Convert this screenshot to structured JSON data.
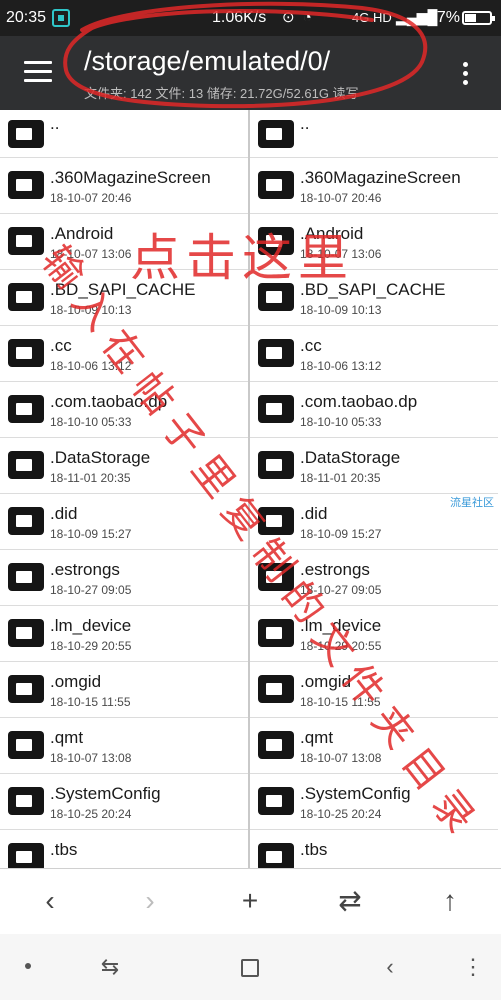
{
  "status_bar": {
    "time": "20:35",
    "speed": "1.06K/s",
    "icons": "⊙ ◔",
    "network": "4G HD",
    "signal": "▂▄▆█",
    "battery_pct": "47%",
    "battery_level": 0.47
  },
  "app_bar": {
    "path": "/storage/emulated/0/",
    "info": "文件夹: 142  文件: 13  储存: 21.72G/52.61G  读写"
  },
  "left_pane": {
    "items": [
      {
        "name": "..",
        "date": ""
      },
      {
        "name": ".360MagazineScreen",
        "date": "18-10-07 20:46"
      },
      {
        "name": ".Android",
        "date": "18-10-07 13:06"
      },
      {
        "name": ".BD_SAPI_CACHE",
        "date": "18-10-09 10:13"
      },
      {
        "name": ".cc",
        "date": "18-10-06 13:12"
      },
      {
        "name": ".com.taobao.dp",
        "date": "18-10-10 05:33"
      },
      {
        "name": ".DataStorage",
        "date": "18-11-01 20:35"
      },
      {
        "name": ".did",
        "date": "18-10-09 15:27"
      },
      {
        "name": ".estrongs",
        "date": "18-10-27 09:05"
      },
      {
        "name": ".lm_device",
        "date": "18-10-29 20:55"
      },
      {
        "name": ".omgid",
        "date": "18-10-15 11:55"
      },
      {
        "name": ".qmt",
        "date": "18-10-07 13:08"
      },
      {
        "name": ".SystemConfig",
        "date": "18-10-25 20:24"
      },
      {
        "name": ".tbs",
        "date": ""
      }
    ]
  },
  "right_pane": {
    "items": [
      {
        "name": "..",
        "date": ""
      },
      {
        "name": ".360MagazineScreen",
        "date": "18-10-07 20:46"
      },
      {
        "name": ".Android",
        "date": "18-10-07 13:06"
      },
      {
        "name": ".BD_SAPI_CACHE",
        "date": "18-10-09 10:13"
      },
      {
        "name": ".cc",
        "date": "18-10-06 13:12"
      },
      {
        "name": ".com.taobao.dp",
        "date": "18-10-10 05:33"
      },
      {
        "name": ".DataStorage",
        "date": "18-11-01 20:35"
      },
      {
        "name": ".did",
        "date": "18-10-09 15:27"
      },
      {
        "name": ".estrongs",
        "date": "18-10-27 09:05"
      },
      {
        "name": ".lm_device",
        "date": "18-10-29 20:55"
      },
      {
        "name": ".omgid",
        "date": "18-10-15 11:55"
      },
      {
        "name": ".qmt",
        "date": "18-10-07 13:08"
      },
      {
        "name": ".SystemConfig",
        "date": "18-10-25 20:24"
      },
      {
        "name": ".tbs",
        "date": ""
      }
    ]
  },
  "annotations": {
    "click_here": "点击这里",
    "instruction": "输入在帖子里复制的文件夹目录"
  },
  "watermark": "流星社区",
  "toolbar": {
    "back": "‹",
    "forward": "›",
    "add": "+",
    "swap": "⇄",
    "up": "↑"
  },
  "nav": {
    "recents_icon": "⇆",
    "back_icon": "‹",
    "menu_icon": "⋮"
  },
  "colors": {
    "appbar": "#2f3032",
    "annotation": "#e02828",
    "watermark": "#3a9ad9"
  }
}
